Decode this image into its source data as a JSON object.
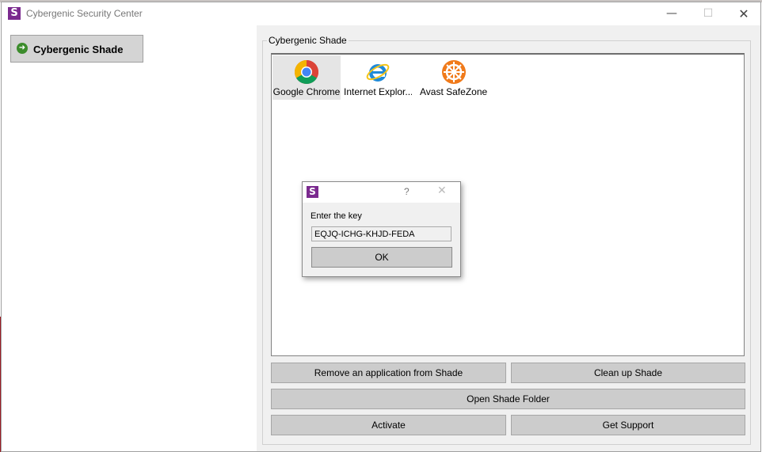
{
  "window": {
    "title": "Cybergenic Security Center",
    "icon_letter": "S",
    "minimize": "—",
    "maximize": "☐",
    "close": "✕"
  },
  "sidebar": {
    "items": [
      {
        "label": "Cybergenic Shade",
        "icon": "arrow-right-circle-icon"
      }
    ]
  },
  "main": {
    "group_title": "Cybergenic Shade",
    "apps": [
      {
        "label": "Google Chrome",
        "icon": "chrome-icon"
      },
      {
        "label": "Internet Explor...",
        "icon": "internet-explorer-icon"
      },
      {
        "label": "Avast SafeZone ...",
        "icon": "avast-safezone-icon"
      }
    ],
    "buttons": {
      "remove": "Remove an application from Shade",
      "cleanup": "Clean up Shade",
      "open_folder": "Open Shade Folder",
      "activate": "Activate",
      "support": "Get Support"
    }
  },
  "dialog": {
    "icon_letter": "S",
    "help": "?",
    "close": "✕",
    "prompt": "Enter the key",
    "key_value": "EQJQ-ICHG-KHJD-FEDA",
    "ok": "OK"
  },
  "colors": {
    "brand_purple": "#7b2a8f",
    "nav_arrow_green": "#3c8c2c",
    "button_gray": "#cccccc"
  }
}
